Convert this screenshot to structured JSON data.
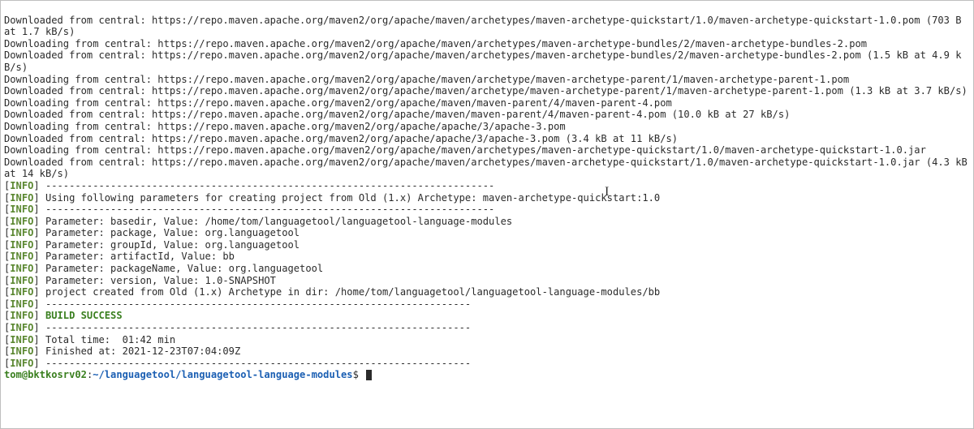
{
  "tags": {
    "info": "INFO"
  },
  "downloads": [
    "Downloaded from central: https://repo.maven.apache.org/maven2/org/apache/maven/archetypes/maven-archetype-quickstart/1.0/maven-archetype-quickstart-1.0.pom (703 B at 1.7 kB/s)",
    "Downloading from central: https://repo.maven.apache.org/maven2/org/apache/maven/archetypes/maven-archetype-bundles/2/maven-archetype-bundles-2.pom",
    "Downloaded from central: https://repo.maven.apache.org/maven2/org/apache/maven/archetypes/maven-archetype-bundles/2/maven-archetype-bundles-2.pom (1.5 kB at 4.9 kB/s)",
    "Downloading from central: https://repo.maven.apache.org/maven2/org/apache/maven/archetype/maven-archetype-parent/1/maven-archetype-parent-1.pom",
    "Downloaded from central: https://repo.maven.apache.org/maven2/org/apache/maven/archetype/maven-archetype-parent/1/maven-archetype-parent-1.pom (1.3 kB at 3.7 kB/s)",
    "Downloading from central: https://repo.maven.apache.org/maven2/org/apache/maven/maven-parent/4/maven-parent-4.pom",
    "Downloaded from central: https://repo.maven.apache.org/maven2/org/apache/maven/maven-parent/4/maven-parent-4.pom (10.0 kB at 27 kB/s)",
    "Downloading from central: https://repo.maven.apache.org/maven2/org/apache/apache/3/apache-3.pom",
    "Downloaded from central: https://repo.maven.apache.org/maven2/org/apache/apache/3/apache-3.pom (3.4 kB at 11 kB/s)",
    "Downloading from central: https://repo.maven.apache.org/maven2/org/apache/maven/archetypes/maven-archetype-quickstart/1.0/maven-archetype-quickstart-1.0.jar",
    "Downloaded from central: https://repo.maven.apache.org/maven2/org/apache/maven/archetypes/maven-archetype-quickstart/1.0/maven-archetype-quickstart-1.0.jar (4.3 kB at 14 kB/s)"
  ],
  "info": {
    "sep1": "----------------------------------------------------------------------------",
    "using_params": "Using following parameters for creating project from Old (1.x) Archetype: maven-archetype-quickstart:1.0",
    "params": [
      "Parameter: basedir, Value: /home/tom/languagetool/languagetool-language-modules",
      "Parameter: package, Value: org.languagetool",
      "Parameter: groupId, Value: org.languagetool",
      "Parameter: artifactId, Value: bb",
      "Parameter: packageName, Value: org.languagetool",
      "Parameter: version, Value: 1.0-SNAPSHOT"
    ],
    "project_created": "project created from Old (1.x) Archetype in dir: /home/tom/languagetool/languagetool-language-modules/bb",
    "sep2": "------------------------------------------------------------------------",
    "build_success": "BUILD SUCCESS",
    "total_time": "Total time:  01:42 min",
    "finished_at": "Finished at: 2021-12-23T07:04:09Z"
  },
  "prompt": {
    "user_host": "tom@bktkosrv02",
    "sep": ":",
    "path": "~/languagetool/languagetool-language-modules",
    "dollar": "$ "
  },
  "caret": {
    "glyph": "I"
  }
}
